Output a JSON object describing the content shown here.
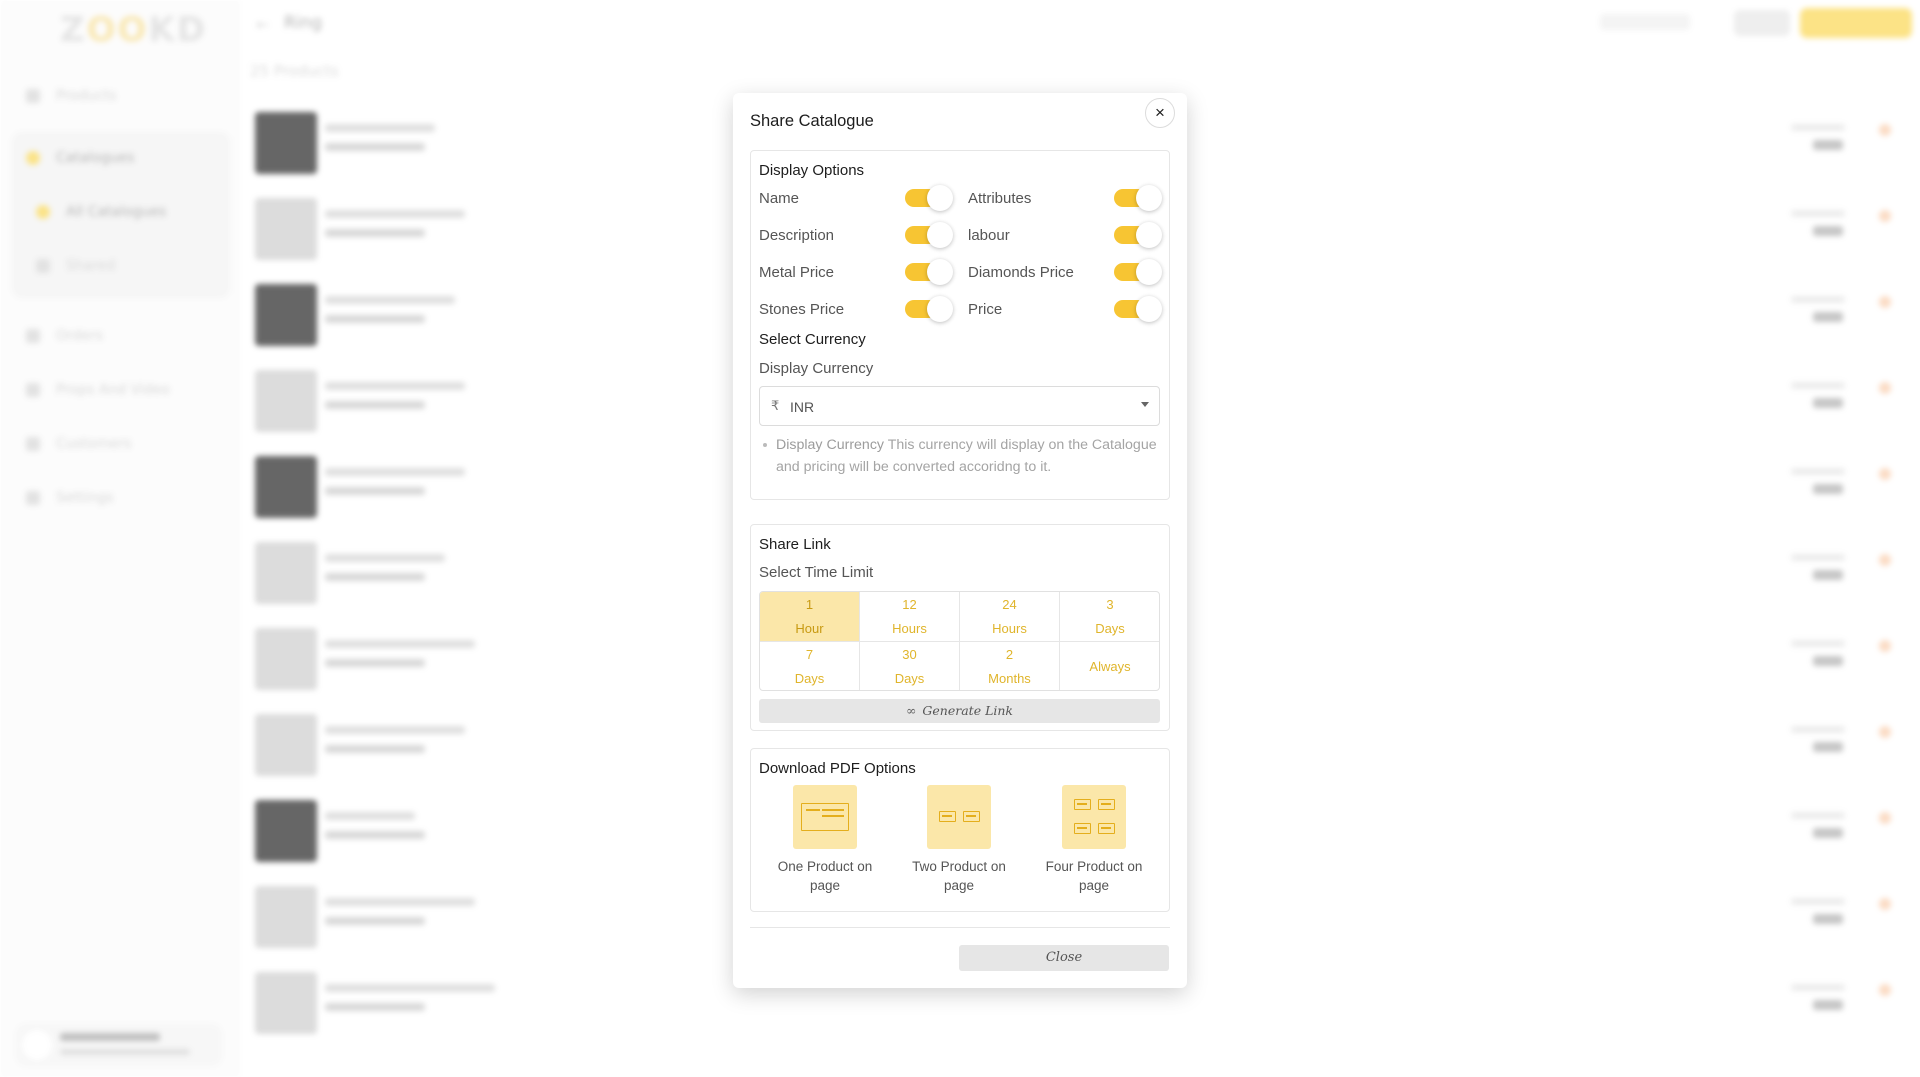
{
  "background": {
    "logo": {
      "left": "Z",
      "middle": "OO",
      "right": "KD"
    },
    "sidebar_items": [
      "Products",
      "Catalogues",
      "All Catalogues",
      "Shared",
      "Orders",
      "Props And Video",
      "Customers",
      "Settings"
    ],
    "page_title": "Ring",
    "product_count": "25 Products"
  },
  "modal": {
    "title": "Share Catalogue",
    "display_options": {
      "heading": "Display Options",
      "options": [
        {
          "label": "Name",
          "enabled": true
        },
        {
          "label": "Attributes",
          "enabled": true
        },
        {
          "label": "Description",
          "enabled": true
        },
        {
          "label": "labour",
          "enabled": true
        },
        {
          "label": "Metal Price",
          "enabled": true
        },
        {
          "label": "Diamonds Price",
          "enabled": true
        },
        {
          "label": "Stones Price",
          "enabled": true
        },
        {
          "label": "Price",
          "enabled": true
        }
      ],
      "currency_heading": "Select Currency",
      "currency_label": "Display Currency",
      "currency_symbol": "₹",
      "currency_value": "INR",
      "hint_strong": "Display Currency",
      "hint_text": " This currency will display on the Catalogue and pricing will be converted accoridng to it."
    },
    "share_link": {
      "heading": "Share Link",
      "time_limit_label": "Select Time Limit",
      "options": [
        {
          "n": "1",
          "u": "Hour",
          "selected": true
        },
        {
          "n": "12",
          "u": "Hours",
          "selected": false
        },
        {
          "n": "24",
          "u": "Hours",
          "selected": false
        },
        {
          "n": "3",
          "u": "Days",
          "selected": false
        },
        {
          "n": "7",
          "u": "Days",
          "selected": false
        },
        {
          "n": "30",
          "u": "Days",
          "selected": false
        },
        {
          "n": "2",
          "u": "Months",
          "selected": false
        },
        {
          "n": "",
          "u": "Always",
          "selected": false
        }
      ],
      "generate_label": "Generate Link",
      "link_icon": "∞"
    },
    "download_pdf": {
      "heading": "Download PDF Options",
      "options": [
        {
          "label": "One Product on page",
          "icon": "one-product-layout-icon"
        },
        {
          "label": "Two Product on page",
          "icon": "two-product-layout-icon"
        },
        {
          "label": "Four Product on page",
          "icon": "four-product-layout-icon"
        }
      ]
    },
    "close_label": "Close",
    "close_icon": "×"
  },
  "colors": {
    "accent": "#f7c533",
    "selected_bg": "#fbe7a9",
    "accent_text": "#e0b52c"
  }
}
